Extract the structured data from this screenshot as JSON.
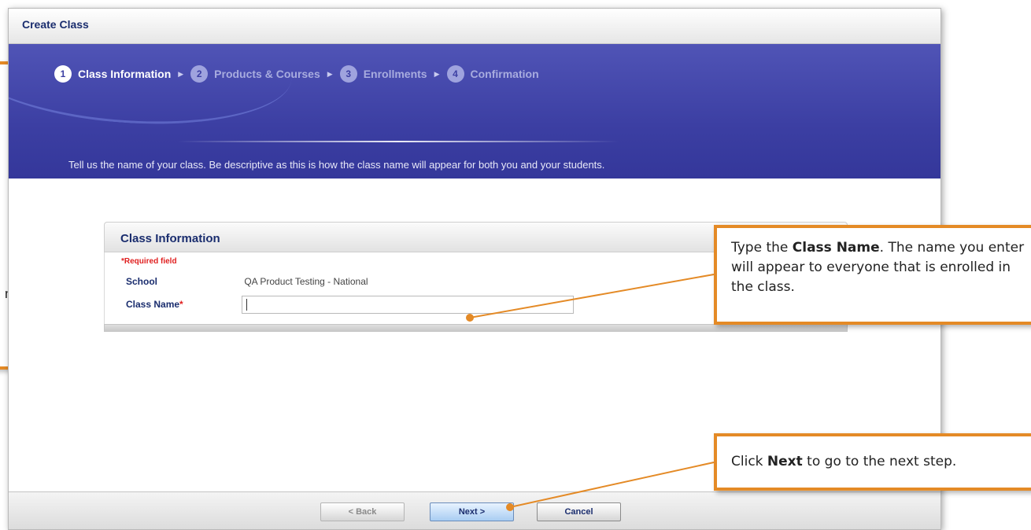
{
  "window": {
    "title": "Create Class"
  },
  "wizard": {
    "steps": [
      {
        "number": "1",
        "label": "Class Information",
        "active": true
      },
      {
        "number": "2",
        "label": "Products & Courses",
        "active": false
      },
      {
        "number": "3",
        "label": "Enrollments",
        "active": false
      },
      {
        "number": "4",
        "label": "Confirmation",
        "active": false
      }
    ],
    "description": "Tell us the name of your class. Be descriptive as this is how the class name will appear for both you and your students."
  },
  "form": {
    "heading": "Class Information",
    "required_note": "*Required field",
    "school_label": "School",
    "school_value": "QA Product Testing - National",
    "class_name_label": "Class Name",
    "class_name_star": "*",
    "class_name_value": ""
  },
  "buttons": {
    "back": "< Back",
    "next": "Next >",
    "cancel": "Cancel"
  },
  "callouts": {
    "class_name": {
      "pre": "Type the ",
      "bold": "Class Name",
      "post": ". The name you enter will appear to everyone that is enrolled in the class."
    },
    "next": {
      "pre": "Click ",
      "bold": "Next",
      "post": " to go to the next step."
    },
    "left_fragment": "n"
  },
  "colors": {
    "accent_orange": "#e48a26",
    "banner_blue": "#3c3fa3",
    "heading_navy": "#1a2d6e",
    "required_red": "#e02020"
  }
}
